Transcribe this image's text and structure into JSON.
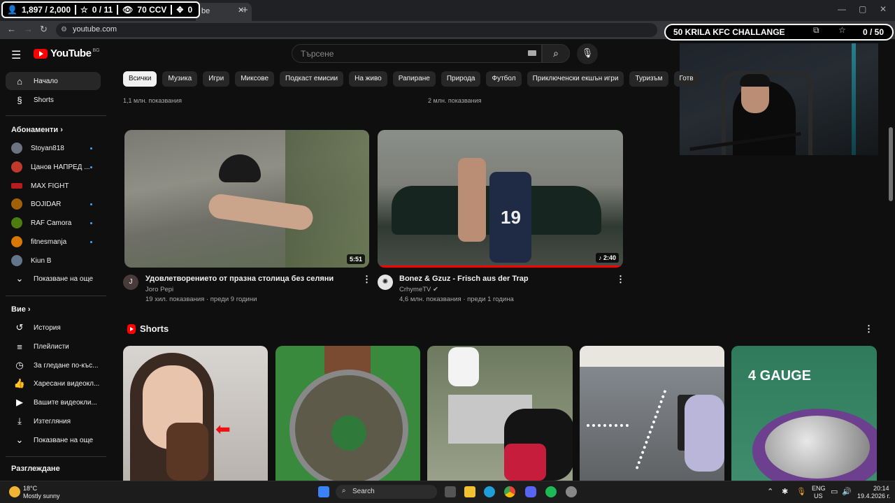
{
  "browser": {
    "tab_title": "be",
    "new_tab": "+",
    "window_controls": [
      "—",
      "▢",
      "✕"
    ],
    "address": "youtube.com"
  },
  "overlay": {
    "followers": "1,897 / 2,000",
    "stars": "0 / 11",
    "viewers": "70 CCV",
    "fourth": "0",
    "challenge": "50 KRILA KFC CHALLANGE",
    "challenge_count": "0 / 50"
  },
  "header": {
    "logo_text": "YouTube",
    "country_code": "BG",
    "search_placeholder": "Търсене"
  },
  "chips": [
    "Всички",
    "Музика",
    "Игри",
    "Миксове",
    "Подкаст емисии",
    "На живо",
    "Рапиране",
    "Природа",
    "Футбол",
    "Приключенски екшън игри",
    "Туризъм",
    "Готв"
  ],
  "sidebar": {
    "main": [
      {
        "label": "Начало",
        "icon": "home-icon"
      },
      {
        "label": "Shorts",
        "icon": "shorts-icon"
      }
    ],
    "subscriptions_heading": "Абонаменти",
    "subscriptions": [
      {
        "label": "Stoyan818",
        "color": "#6b7280",
        "dot": true
      },
      {
        "label": "Цанов НАПРЕД ...",
        "color": "#c0392b",
        "dot": true
      },
      {
        "label": "MAX FIGHT",
        "color": "#b91c1c",
        "dot": false
      },
      {
        "label": "BOJIDAR",
        "color": "#a16207",
        "dot": true
      },
      {
        "label": "RAF Camora",
        "color": "#4d7c0f",
        "dot": true
      },
      {
        "label": "fitnesmanja",
        "color": "#d97706",
        "dot": true
      },
      {
        "label": "Kiun B",
        "color": "#64748b",
        "dot": false
      }
    ],
    "show_more": "Показване на още",
    "you_heading": "Вие",
    "you_items": [
      {
        "label": "История",
        "icon": "history-icon"
      },
      {
        "label": "Плейлисти",
        "icon": "playlists-icon"
      },
      {
        "label": "За гледане по-къс...",
        "icon": "watch-later-icon"
      },
      {
        "label": "Харесани видеокл...",
        "icon": "liked-icon"
      },
      {
        "label": "Вашите видеокли...",
        "icon": "your-videos-icon"
      },
      {
        "label": "Изтегляния",
        "icon": "download-icon"
      },
      {
        "label": "Показване на още",
        "icon": "chevron-down-icon"
      }
    ],
    "explore_heading": "Разглеждане"
  },
  "row_top": {
    "stats_left": "1,1 млн. показвания",
    "stats_right": "2 млн. показвания"
  },
  "videos": [
    {
      "title": "Удовлетворението от празна столица без селяни",
      "channel": "Joro Pepi",
      "stats": "19 хил. показвания · преди 9 години",
      "duration": "5:51",
      "avatar_letter": "J",
      "verified": false
    },
    {
      "title": "Bonez & Gzuz - Frisch aus der Trap",
      "channel": "CrhymeTV",
      "stats": "4,6 млн. показвания · преди 1 година",
      "duration": "♪ 2:40",
      "avatar_letter": "",
      "verified": true
    }
  ],
  "shorts": {
    "heading": "Shorts",
    "overlay_text_5": "4 GAUGE"
  },
  "taskbar": {
    "weather_temp": "18°C",
    "weather_desc": "Mostly sunny",
    "search": "Search",
    "lang": "ENG",
    "region": "US",
    "time": "20:14",
    "date": "19.4.2026 г."
  }
}
